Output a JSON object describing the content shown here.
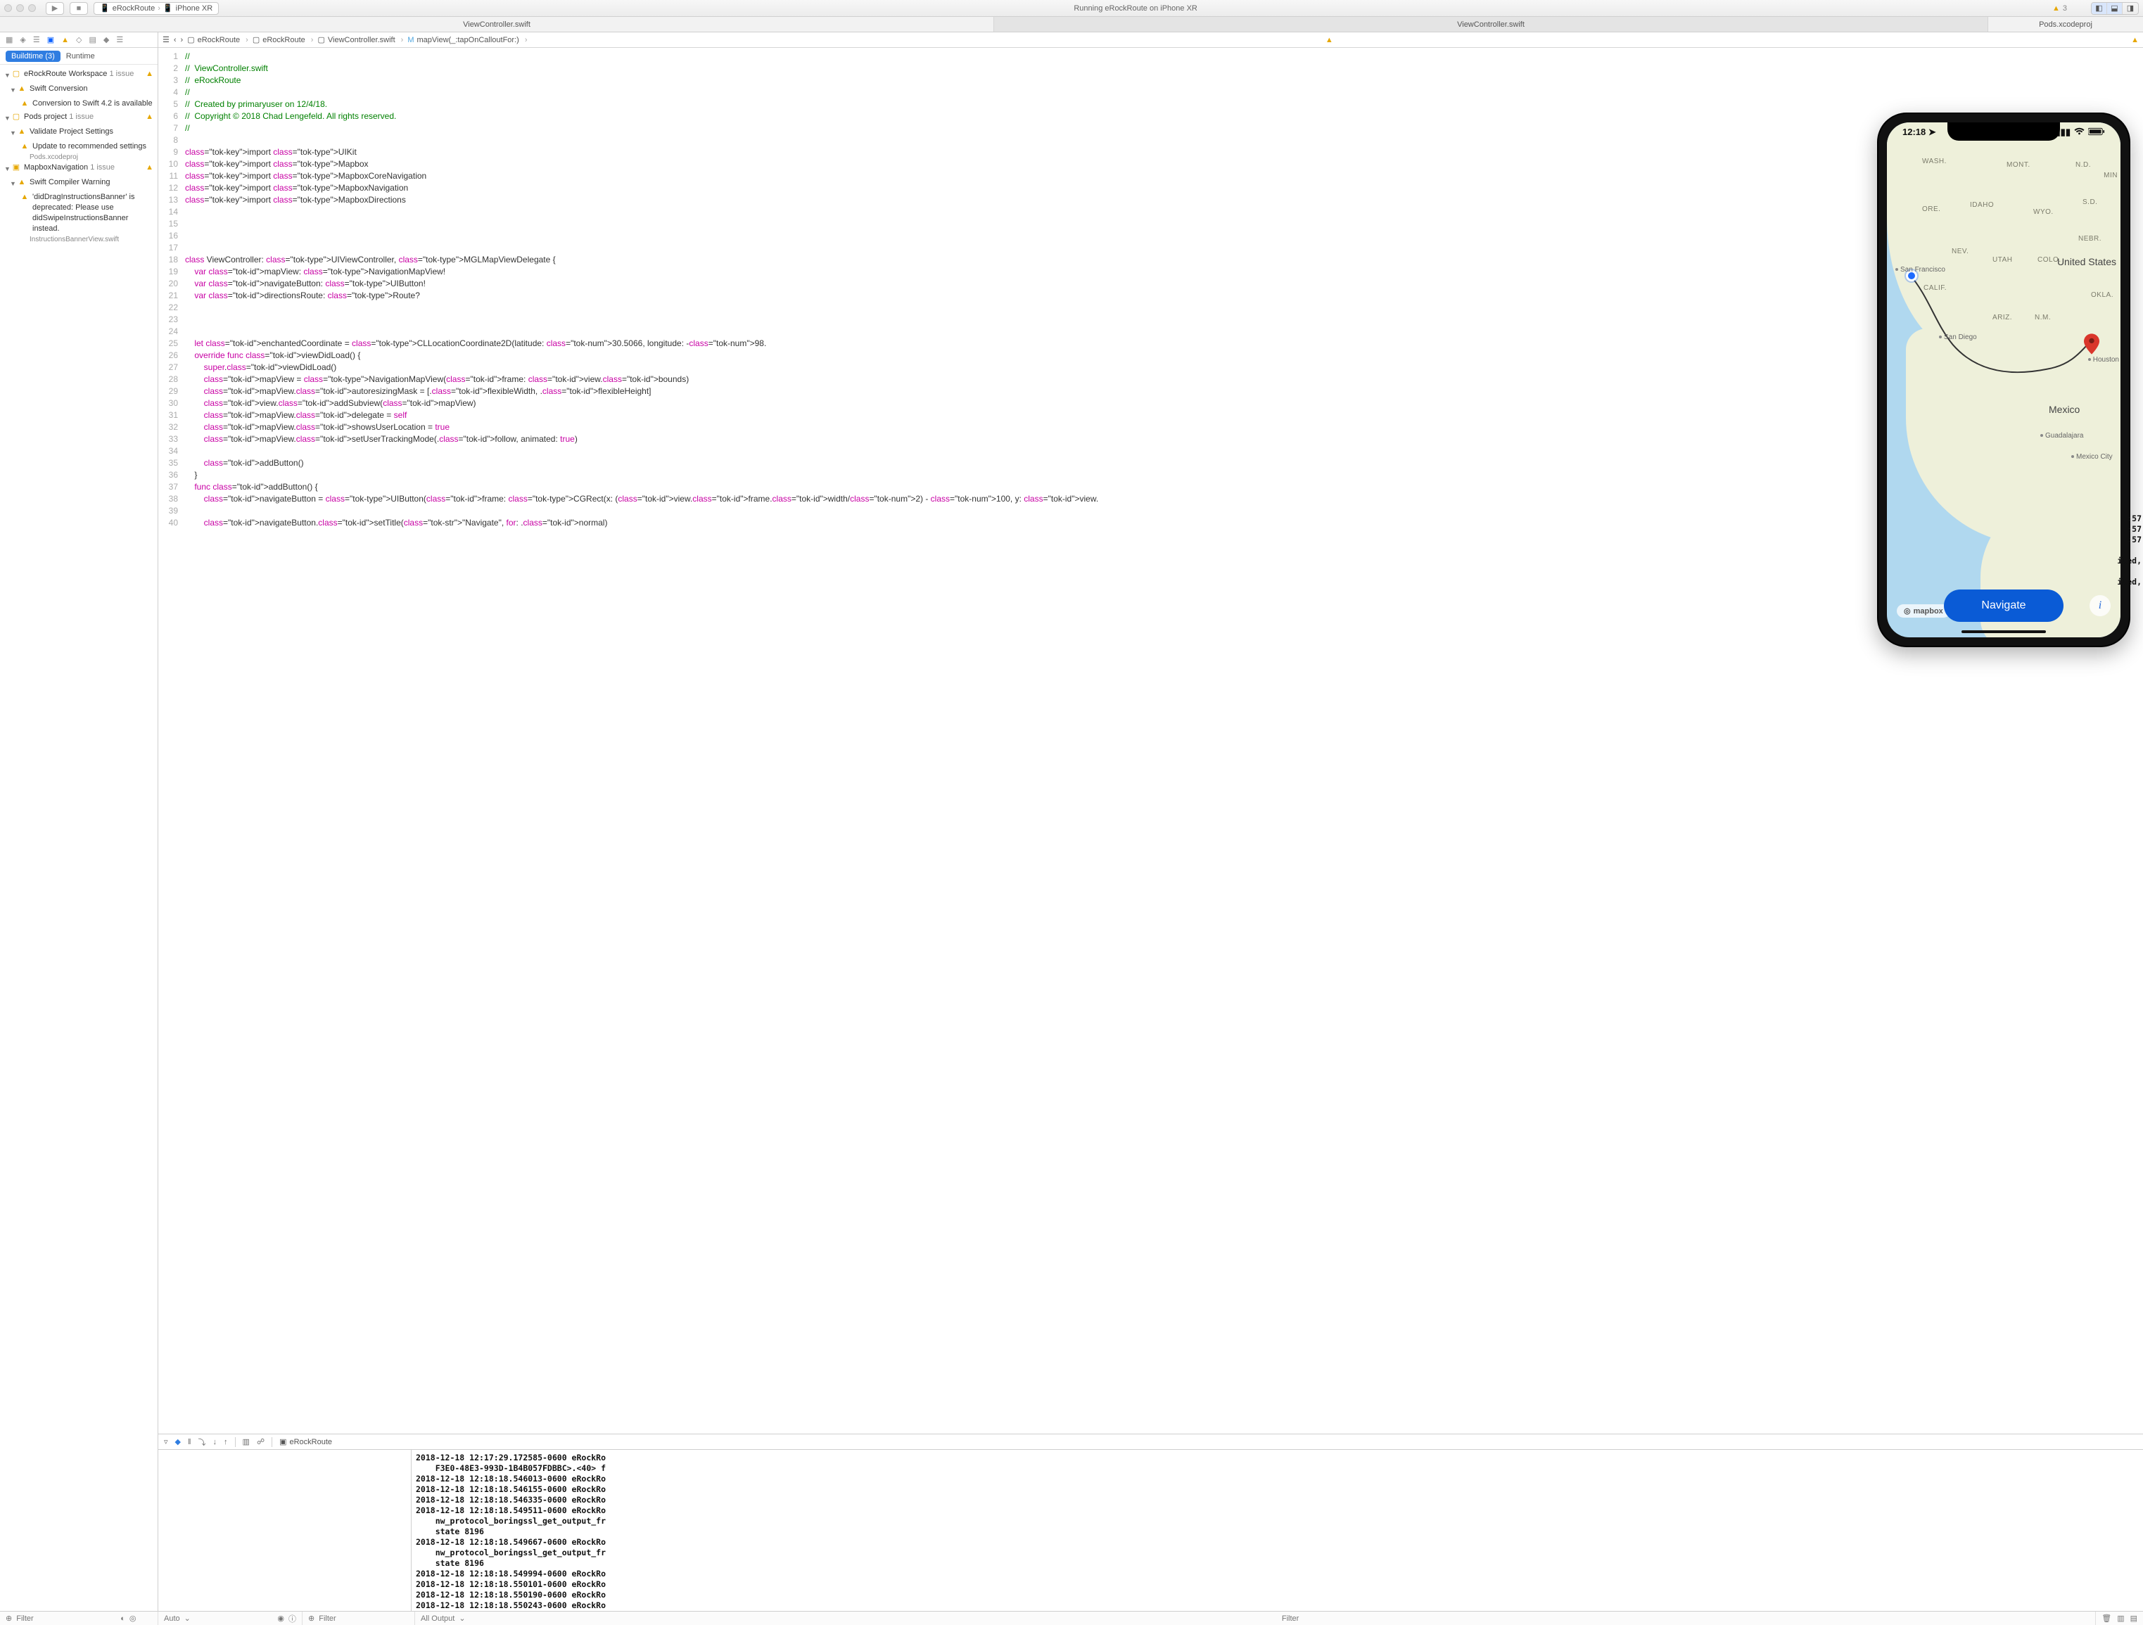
{
  "toolbar": {
    "scheme_app": "eRockRoute",
    "scheme_device": "iPhone XR",
    "status": "Running eRockRoute on iPhone XR",
    "warning_count": "3"
  },
  "tabs": {
    "left": "ViewController.swift",
    "center": "ViewController.swift",
    "right": "Pods.xcodeproj"
  },
  "navigator": {
    "buildtime_label": "Buildtime  (3)",
    "runtime_label": "Runtime",
    "items": {
      "workspace": "eRockRoute Workspace",
      "workspace_issue": "1 issue",
      "swift_conv": "Swift Conversion",
      "swift_conv_msg": "Conversion to Swift 4.2 is available",
      "pods_proj": "Pods project",
      "pods_issue": "1 issue",
      "validate": "Validate Project Settings",
      "validate_msg": "Update to recommended settings",
      "validate_file": "Pods.xcodeproj",
      "mapbox": "MapboxNavigation",
      "mapbox_issue": "1 issue",
      "compiler": "Swift Compiler Warning",
      "compiler_msg": "'didDragInstructionsBanner' is deprecated: Please use didSwipeInstructionsBanner instead.",
      "compiler_file": "InstructionsBannerView.swift"
    }
  },
  "jumpbar": {
    "c1": "eRockRoute",
    "c2": "eRockRoute",
    "c3": "ViewController.swift",
    "c4": "mapView(_:tapOnCalloutFor:)"
  },
  "code": {
    "lines": [
      "//",
      "//  ViewController.swift",
      "//  eRockRoute",
      "//",
      "//  Created by primaryuser on 12/4/18.",
      "//  Copyright © 2018 Chad Lengefeld. All rights reserved.",
      "//",
      "",
      "import UIKit",
      "import Mapbox",
      "import MapboxCoreNavigation",
      "import MapboxNavigation",
      "import MapboxDirections",
      "",
      "",
      "",
      "",
      "class ViewController: UIViewController, MGLMapViewDelegate {",
      "    var mapView: NavigationMapView!",
      "    var navigateButton: UIButton!",
      "    var directionsRoute: Route?",
      "",
      "",
      "",
      "    let enchantedCoordinate = CLLocationCoordinate2D(latitude: 30.5066, longitude: -98.",
      "    override func viewDidLoad() {",
      "        super.viewDidLoad()",
      "        mapView = NavigationMapView(frame: view.bounds)",
      "        mapView.autoresizingMask = [.flexibleWidth, .flexibleHeight]",
      "        view.addSubview(mapView)",
      "        mapView.delegate = self",
      "        mapView.showsUserLocation = true",
      "        mapView.setUserTrackingMode(.follow, animated: true)",
      "",
      "        addButton()",
      "    }",
      "    func addButton() {",
      "        navigateButton = UIButton(frame: CGRect(x: (view.frame.width/2) - 100, y: view.",
      "",
      "        navigateButton.setTitle(\"Navigate\", for: .normal)"
    ],
    "first_line_no": 1
  },
  "debugbar": {
    "target": "eRockRoute"
  },
  "console_lines": [
    "2018-12-18 12:17:29.172585-0600 eRockRo",
    "    F3E0-48E3-993D-1B4B057FDBBC>.<40> f",
    "2018-12-18 12:18:18.546013-0600 eRockRo",
    "2018-12-18 12:18:18.546155-0600 eRockRo",
    "2018-12-18 12:18:18.546335-0600 eRockRo",
    "2018-12-18 12:18:18.549511-0600 eRockRo",
    "    nw_protocol_boringssl_get_output_fr",
    "    state 8196",
    "2018-12-18 12:18:18.549667-0600 eRockRo",
    "    nw_protocol_boringssl_get_output_fr",
    "    state 8196",
    "2018-12-18 12:18:18.549994-0600 eRockRo",
    "2018-12-18 12:18:18.550101-0600 eRockRo",
    "2018-12-18 12:18:18.550190-0600 eRockRo",
    "2018-12-18 12:18:18.550243-0600 eRockRo"
  ],
  "console_right": [
    ":57",
    ":57",
    ":57",
    "",
    "iled,",
    "",
    "iled,"
  ],
  "bottom": {
    "filter": "Filter",
    "auto": "Auto",
    "all_output": "All Output"
  },
  "sim": {
    "time": "12:18",
    "map_labels": {
      "wash": "Wash.",
      "mont": "Mont.",
      "nd": "N.D.",
      "min": "Min",
      "ore": "Ore.",
      "idaho": "Idaho",
      "wyo": "Wyo.",
      "sd": "S.D.",
      "nebr": "Nebr.",
      "nev": "Nev.",
      "utah": "Utah",
      "colo": "Colo.",
      "us": "United States",
      "calif": "Calif.",
      "ariz": "Ariz.",
      "nm": "N.M.",
      "okla": "Okla.",
      "houston": "Houston",
      "mexico": "Mexico",
      "sf": "San Francisco",
      "sd_city": "San Diego",
      "guad": "Guadalajara",
      "mxcity": "Mexico City"
    },
    "mapbox": "mapbox",
    "navigate": "Navigate"
  }
}
